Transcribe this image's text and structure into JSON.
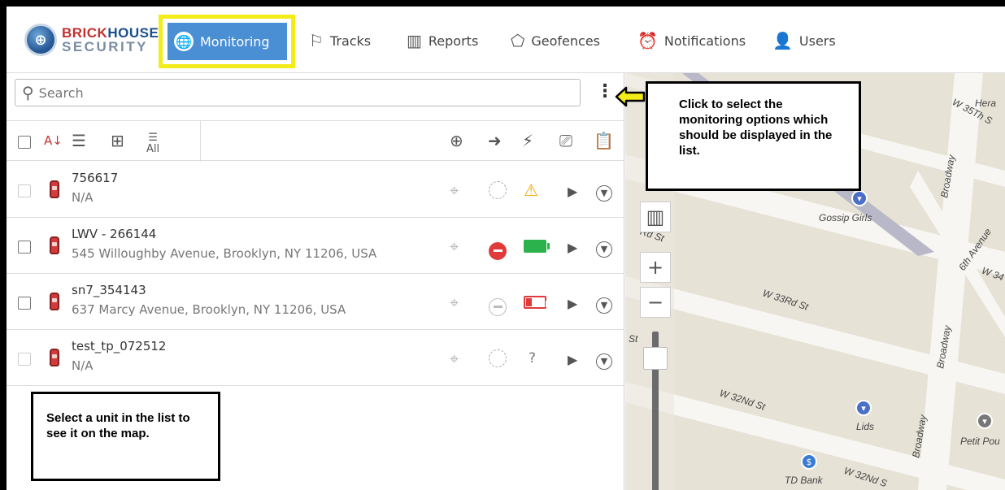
{
  "brand": {
    "line1a": "BRICK",
    "line1b": "HOUSE",
    "line2": "SECURITY"
  },
  "nav": {
    "monitoring": "Monitoring",
    "tracks": "Tracks",
    "reports": "Reports",
    "geofences": "Geofences",
    "notifications": "Notifications",
    "users": "Users"
  },
  "search": {
    "placeholder": "Search"
  },
  "toolbar": {
    "all_label": "All"
  },
  "units": [
    {
      "name": "756617",
      "address": "N/A",
      "battery": "warning"
    },
    {
      "name": "LWV - 266144",
      "address": "545 Willoughby Avenue, Brooklyn, NY 11206, USA",
      "battery": "full"
    },
    {
      "name": "sn7_354143",
      "address": "637 Marcy Avenue, Brooklyn, NY 11206, USA",
      "battery": "low"
    },
    {
      "name": "test_tp_072512",
      "address": "N/A",
      "battery": "unknown"
    }
  ],
  "callouts": {
    "options": "Click to select the monitoring options which should be displayed in the list.",
    "select": "Select a unit in the list to see it on the map."
  },
  "map": {
    "streets": [
      "W 35Th S",
      "Hera",
      "Broadway",
      "Gossip Girls",
      "6th Avenue",
      "W 34",
      "W 33Rd St",
      "Rd St",
      "W 32Nd St",
      "Lids",
      "Broadway",
      "Broadway",
      "Petit Pou",
      "TD Bank",
      "W 32Nd S",
      "St"
    ],
    "zoom_in": "+",
    "zoom_out": "−"
  },
  "colors": {
    "accent": "#4a8ed4",
    "highlight": "#f2ec18",
    "battery_green": "#2bb24c",
    "battery_red": "#e03a3a",
    "warning": "#f0a500"
  }
}
